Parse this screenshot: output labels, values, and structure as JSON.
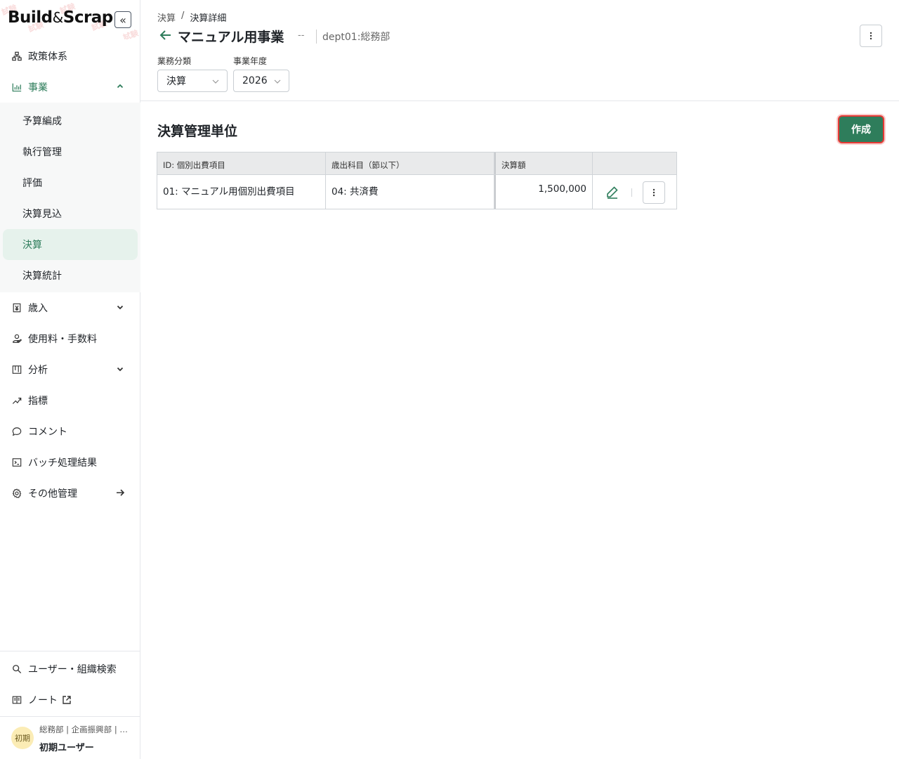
{
  "app": {
    "logo_part1": "Build",
    "logo_amp": "&",
    "logo_part2": "Scrap",
    "watermark": "試験"
  },
  "sidebar": {
    "collapse_label": "«",
    "items": [
      {
        "label": "政策体系",
        "icon": "hierarchy-icon"
      },
      {
        "label": "事業",
        "icon": "bar-chart-icon",
        "expanded": true
      },
      {
        "label": "歳入",
        "icon": "yen-doc-icon"
      },
      {
        "label": "使用料・手数料",
        "icon": "hand-coin-icon"
      },
      {
        "label": "分析",
        "icon": "board-icon"
      },
      {
        "label": "指標",
        "icon": "trend-icon"
      },
      {
        "label": "コメント",
        "icon": "chat-icon"
      },
      {
        "label": "バッチ処理結果",
        "icon": "terminal-icon"
      },
      {
        "label": "その他管理",
        "icon": "gear-icon"
      }
    ],
    "sub_items": [
      {
        "label": "予算編成"
      },
      {
        "label": "執行管理"
      },
      {
        "label": "評価"
      },
      {
        "label": "決算見込"
      },
      {
        "label": "決算",
        "selected": true
      },
      {
        "label": "決算統計"
      }
    ],
    "bottom_items": [
      {
        "label": "ユーザー・組織検索",
        "icon": "search-icon"
      },
      {
        "label": "ノート",
        "icon": "book-icon"
      }
    ],
    "user": {
      "avatar": "初期",
      "org": "総務部 | 企画振興部 | …",
      "name": "初期ユーザー"
    }
  },
  "header": {
    "breadcrumb": [
      "決算",
      "/",
      "決算詳細"
    ],
    "title": "マニュアル用事業",
    "title_sep": "--",
    "dept": "dept01:総務部"
  },
  "filters": {
    "category_label": "業務分類",
    "category_value": "決算",
    "year_label": "事業年度",
    "year_value": "2026"
  },
  "section": {
    "title": "決算管理単位",
    "create_label": "作成"
  },
  "table": {
    "headers": [
      "ID: 個別出費項目",
      "歳出科目（節以下）",
      "決算額",
      ""
    ],
    "rows": [
      {
        "id": "01: マニュアル用個別出費項目",
        "subject": "04: 共済費",
        "amount": "1,500,000"
      }
    ]
  },
  "colors": {
    "accent": "#2e7d5b",
    "highlight": "#e53935",
    "selected_bg": "#e6f2ec"
  }
}
